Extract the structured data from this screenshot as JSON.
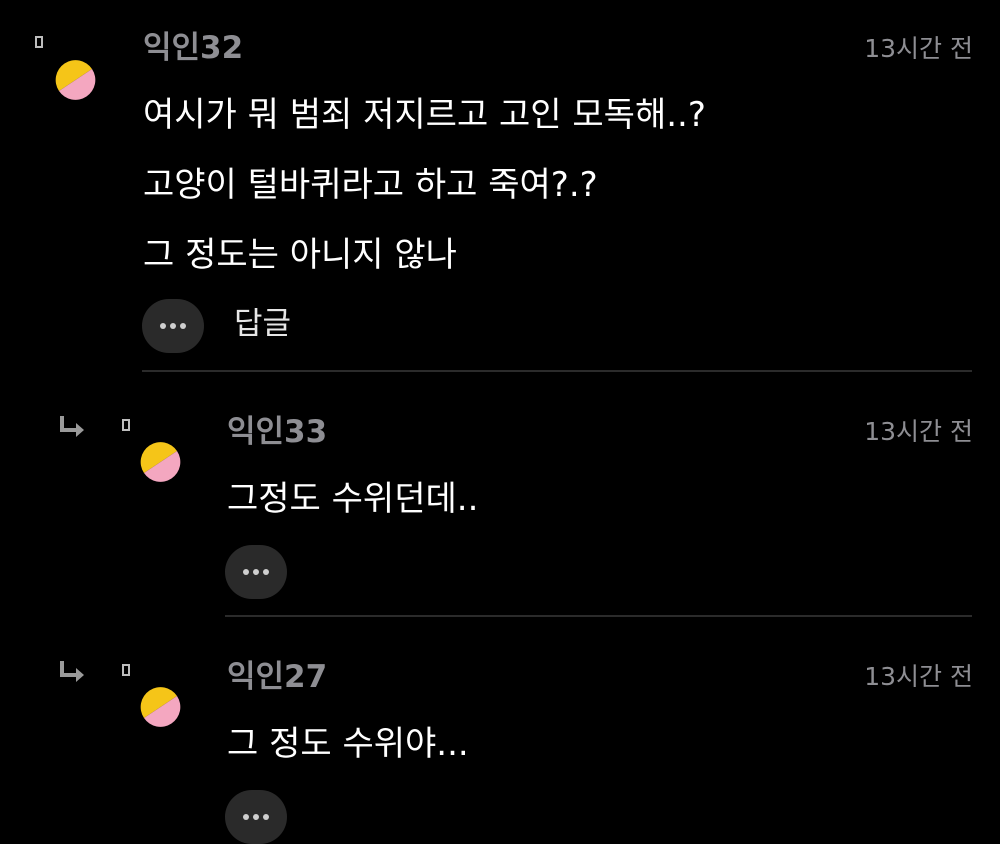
{
  "colors": {
    "background": "#000000",
    "username": "#8e8e93",
    "timestamp": "#8e8e93",
    "body_text": "#ffffff",
    "more_button_bg": "#2a2a2a",
    "divider": "#2b2b2b",
    "avatar_top": "#f5c518",
    "avatar_bottom": "#f4a7c0"
  },
  "comments": [
    {
      "username": "익인32",
      "time": "13시간 전",
      "lines": [
        "여시가 뭐 범죄 저지르고 고인 모독해..?",
        "고양이 털바퀴라고 하고 죽여?.?",
        "그 정도는 아니지 않나"
      ],
      "more_icon": "more-dots-icon",
      "reply_label": "답글"
    },
    {
      "username": "익인33",
      "time": "13시간 전",
      "lines": [
        "그정도 수위던데.."
      ],
      "more_icon": "more-dots-icon",
      "reply_icon": "reply-arrow-icon"
    },
    {
      "username": "익인27",
      "time": "13시간 전",
      "lines": [
        "그 정도 수위야..."
      ],
      "more_icon": "more-dots-icon",
      "reply_icon": "reply-arrow-icon"
    }
  ]
}
